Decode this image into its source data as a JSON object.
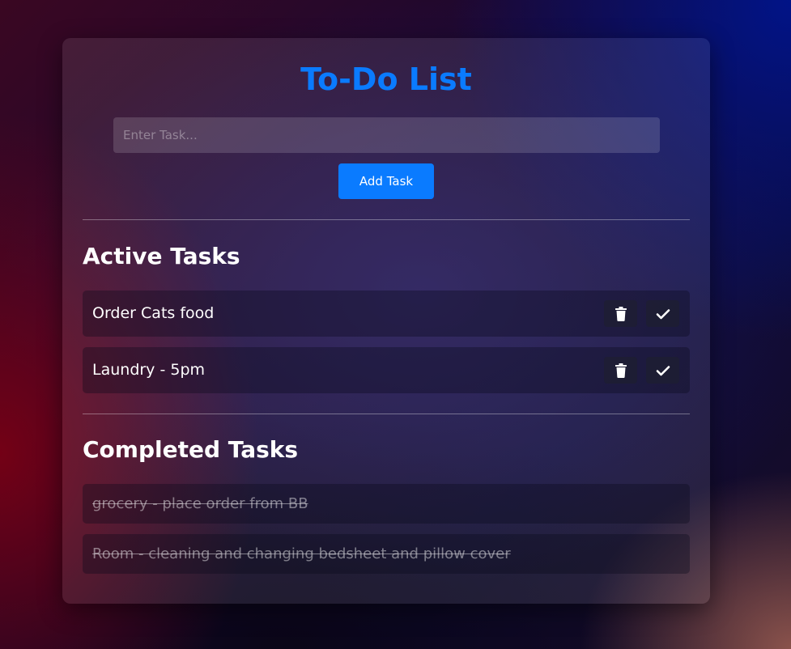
{
  "app": {
    "title": "To-Do List"
  },
  "input": {
    "placeholder": "Enter Task...",
    "value": ""
  },
  "add_button": {
    "label": "Add Task"
  },
  "active_section": {
    "heading": "Active Tasks",
    "tasks": [
      {
        "text": "Order Cats food",
        "actions": [
          "trash-icon",
          "check-icon"
        ]
      },
      {
        "text": "Laundry - 5pm",
        "actions": [
          "trash-icon",
          "check-icon"
        ]
      }
    ]
  },
  "completed_section": {
    "heading": "Completed Tasks",
    "tasks": [
      {
        "text": "grocery - place order from BB"
      },
      {
        "text": "Room - cleaning and changing bedsheet and pillow cover"
      }
    ]
  },
  "colors": {
    "accent": "#0a7bff",
    "text": "#ffffff"
  }
}
